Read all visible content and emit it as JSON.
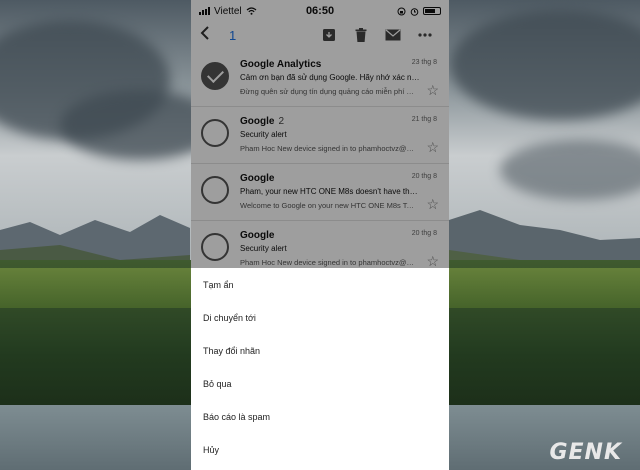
{
  "status_bar": {
    "carrier": "Viettel",
    "time": "06:50"
  },
  "toolbar": {
    "back_icon": "arrow-left-icon",
    "selected_count": "1",
    "icons": [
      "move-to-icon",
      "trash-icon",
      "mail-icon",
      "more-icon"
    ]
  },
  "emails": [
    {
      "sender": "Google Analytics",
      "count": "",
      "date": "23 thg 8",
      "subject": "Cảm ơn bạn đã sử dụng Google. Hãy nhớ xác nhận tin...",
      "snippet": "Đừng quên sử dụng tín dụng quảng cáo miễn phí để th...",
      "selected": true
    },
    {
      "sender": "Google",
      "count": "2",
      "date": "21 thg 8",
      "subject": "Security alert",
      "snippet": "Pham Hoc New device signed in to phamhoctvz@gma...",
      "selected": false
    },
    {
      "sender": "Google",
      "count": "",
      "date": "20 thg 8",
      "subject": "Pham, your new HTC ONE M8s doesn't have the latest...",
      "snippet": "Welcome to Google on your new HTC ONE M8s Take t...",
      "selected": false
    },
    {
      "sender": "Google",
      "count": "",
      "date": "20 thg 8",
      "subject": "Security alert",
      "snippet": "Pham Hoc New device signed in to phamhoctvz@gma...",
      "selected": false
    }
  ],
  "action_sheet": {
    "items": [
      "Tạm ẩn",
      "Di chuyển tới",
      "Thay đổi nhãn",
      "Bỏ qua",
      "Báo cáo là spam",
      "Hủy"
    ]
  },
  "watermark": "GENK"
}
